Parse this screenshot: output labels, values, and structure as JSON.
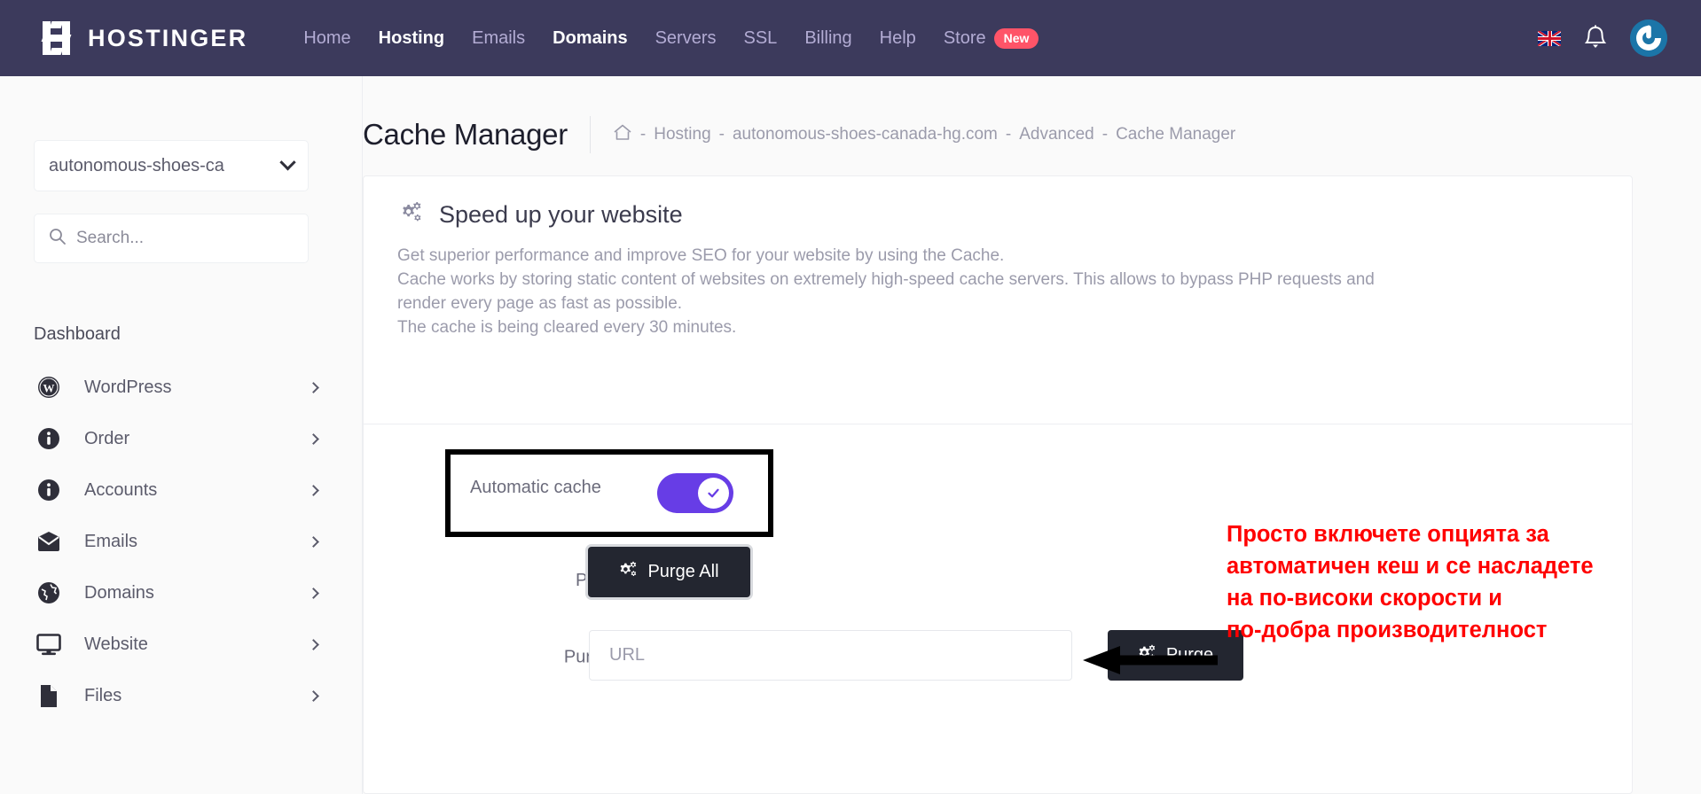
{
  "topnav": {
    "brand": "HOSTINGER",
    "items": [
      {
        "label": "Home",
        "active": false
      },
      {
        "label": "Hosting",
        "active": true
      },
      {
        "label": "Emails",
        "active": false
      },
      {
        "label": "Domains",
        "active": true
      },
      {
        "label": "Servers",
        "active": false
      },
      {
        "label": "SSL",
        "active": false
      },
      {
        "label": "Billing",
        "active": false
      },
      {
        "label": "Help",
        "active": false
      },
      {
        "label": "Store",
        "active": false,
        "badge": "New"
      }
    ],
    "badge_label": "New",
    "badge_color": "#ff5468",
    "bar_color": "#3c3a5c",
    "icons": {
      "language": "uk-flag-icon",
      "notifications": "bell-icon",
      "account": "avatar-icon"
    }
  },
  "sidebar": {
    "domain_selector": "autonomous-shoes-ca",
    "search_placeholder": "Search...",
    "search_value": "",
    "section_label": "Dashboard",
    "items": [
      {
        "label": "WordPress",
        "icon": "wordpress-icon"
      },
      {
        "label": "Order",
        "icon": "info-circle-icon"
      },
      {
        "label": "Accounts",
        "icon": "info-circle-icon"
      },
      {
        "label": "Emails",
        "icon": "envelope-icon"
      },
      {
        "label": "Domains",
        "icon": "globe-icon"
      },
      {
        "label": "Website",
        "icon": "monitor-icon"
      },
      {
        "label": "Files",
        "icon": "file-icon"
      }
    ]
  },
  "header": {
    "title": "Cache Manager",
    "breadcrumb": [
      "Hosting",
      "autonomous-shoes-canada-hg.com",
      "Advanced",
      "Cache Manager"
    ],
    "breadcrumb_separator": "-",
    "home_icon": "home-icon"
  },
  "card": {
    "icon": "cogs-icon",
    "title": "Speed up your website",
    "description_lines": [
      "Get superior performance and improve SEO for your website by using the Cache.",
      "Cache works by storing static content of websites on extremely high-speed cache servers. This allows to bypass PHP requests and",
      "render every page as fast as possible.",
      "The cache is being cleared every 30 minutes."
    ],
    "automatic_cache": {
      "label": "Automatic cache",
      "state": "on",
      "color": "#673de6",
      "knob_icon": "check-icon"
    },
    "purge_manually": {
      "label": "Purge Manually",
      "button_label": "Purge All",
      "button_icon": "cogs-icon"
    },
    "purge_specific": {
      "label": "Purge a specific URL",
      "required_marker": "*",
      "input_placeholder": "URL",
      "input_value": "",
      "button_label": "Purge",
      "button_icon": "cogs-icon"
    }
  },
  "annotation": {
    "color": "#ff0000",
    "arrow_icon": "left-arrow-icon",
    "lines": [
      "Просто включете опцията за",
      "автоматичен кеш и се насладете",
      "на по-високи скорости и",
      "по-добра производителност"
    ]
  }
}
